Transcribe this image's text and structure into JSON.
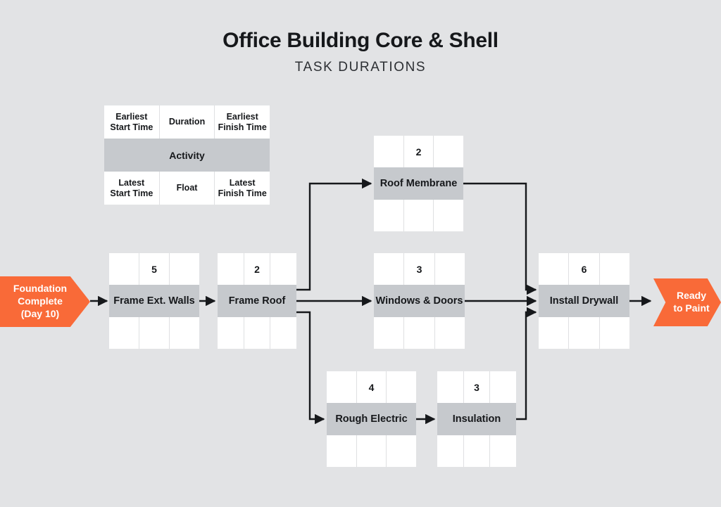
{
  "header": {
    "title": "Office Building Core & Shell",
    "subtitle": "TASK DURATIONS"
  },
  "legend": {
    "earliest_start_time": "Earliest\nStart Time",
    "duration": "Duration",
    "earliest_finish_time": "Earliest\nFinish Time",
    "activity": "Activity",
    "latest_start_time": "Latest\nStart Time",
    "float": "Float",
    "latest_finish_time": "Latest\nFinish Time"
  },
  "terminators": {
    "start": "Foundation\nComplete\n(Day 10)",
    "end": "Ready\nto Paint"
  },
  "colors": {
    "background": "#e2e3e5",
    "accent": "#f96a38",
    "activity_band": "#c6c9cd",
    "cell": "#ffffff",
    "divider": "#dfe0e2",
    "connector": "#16181b",
    "text": "#16181b"
  },
  "chart_data": {
    "type": "diagram",
    "diagram_kind": "activity-on-node-network",
    "title": "Office Building Core & Shell",
    "subtitle": "TASK DURATIONS",
    "nodes": [
      {
        "id": "frame_ext_walls",
        "label": "Frame Ext. Walls",
        "duration": "5",
        "est": "",
        "eft": "",
        "lst": "",
        "float": "",
        "lft": ""
      },
      {
        "id": "frame_roof",
        "label": "Frame Roof",
        "duration": "2",
        "est": "",
        "eft": "",
        "lst": "",
        "float": "",
        "lft": ""
      },
      {
        "id": "roof_membrane",
        "label": "Roof Membrane",
        "duration": "2",
        "est": "",
        "eft": "",
        "lst": "",
        "float": "",
        "lft": ""
      },
      {
        "id": "windows_doors",
        "label": "Windows & Doors",
        "duration": "3",
        "est": "",
        "eft": "",
        "lst": "",
        "float": "",
        "lft": ""
      },
      {
        "id": "rough_electric",
        "label": "Rough Electric",
        "duration": "4",
        "est": "",
        "eft": "",
        "lst": "",
        "float": "",
        "lft": ""
      },
      {
        "id": "insulation",
        "label": "Insulation",
        "duration": "3",
        "est": "",
        "eft": "",
        "lst": "",
        "float": "",
        "lft": ""
      },
      {
        "id": "install_drywall",
        "label": "Install Drywall",
        "duration": "6",
        "est": "",
        "eft": "",
        "lst": "",
        "float": "",
        "lft": ""
      }
    ],
    "terminators": [
      {
        "id": "start",
        "label": "Foundation Complete (Day 10)"
      },
      {
        "id": "end",
        "label": "Ready to Paint"
      }
    ],
    "edges": [
      {
        "from": "start",
        "to": "frame_ext_walls"
      },
      {
        "from": "frame_ext_walls",
        "to": "frame_roof"
      },
      {
        "from": "frame_roof",
        "to": "roof_membrane"
      },
      {
        "from": "frame_roof",
        "to": "windows_doors"
      },
      {
        "from": "frame_roof",
        "to": "rough_electric"
      },
      {
        "from": "roof_membrane",
        "to": "install_drywall"
      },
      {
        "from": "windows_doors",
        "to": "install_drywall"
      },
      {
        "from": "rough_electric",
        "to": "insulation"
      },
      {
        "from": "insulation",
        "to": "install_drywall"
      },
      {
        "from": "install_drywall",
        "to": "end"
      }
    ]
  }
}
